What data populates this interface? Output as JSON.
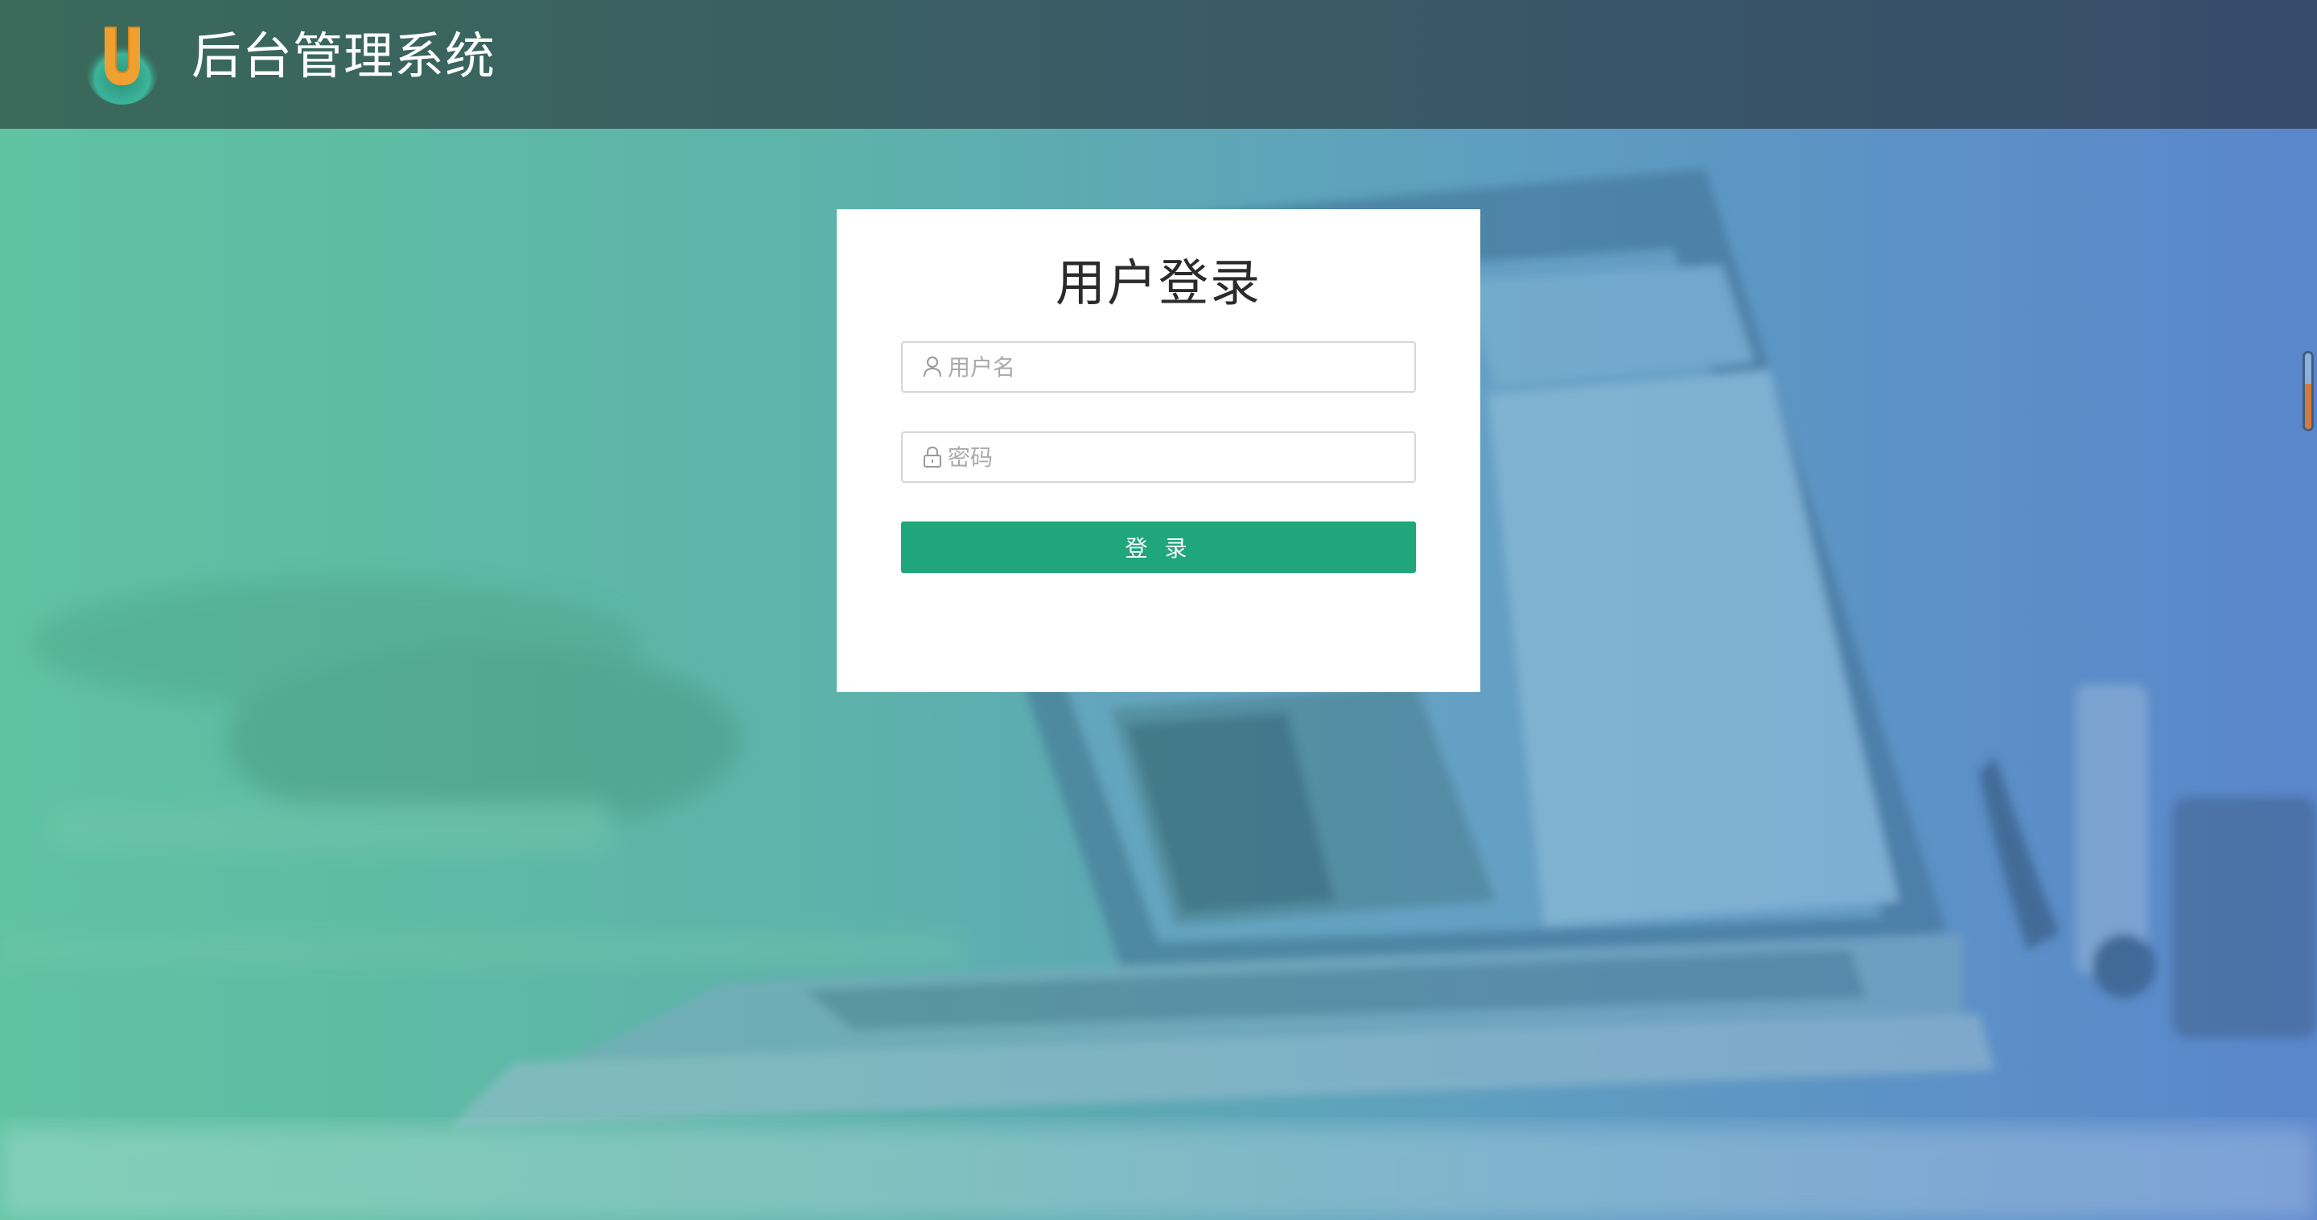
{
  "header": {
    "title": "后台管理系统",
    "logo_letter": "U"
  },
  "login": {
    "title": "用户登录",
    "username": {
      "placeholder": "用户名",
      "value": ""
    },
    "password": {
      "placeholder": "密码",
      "value": ""
    },
    "submit_label": "登 录"
  },
  "colors": {
    "header_bg": "#3a5c66",
    "button": "#1fa67a",
    "gradient_left": "#5fc3a1",
    "gradient_right": "#5a86cc",
    "logo_orange": "#f0a030"
  },
  "icons": {
    "username_icon": "user-icon",
    "password_icon": "lock-icon"
  }
}
